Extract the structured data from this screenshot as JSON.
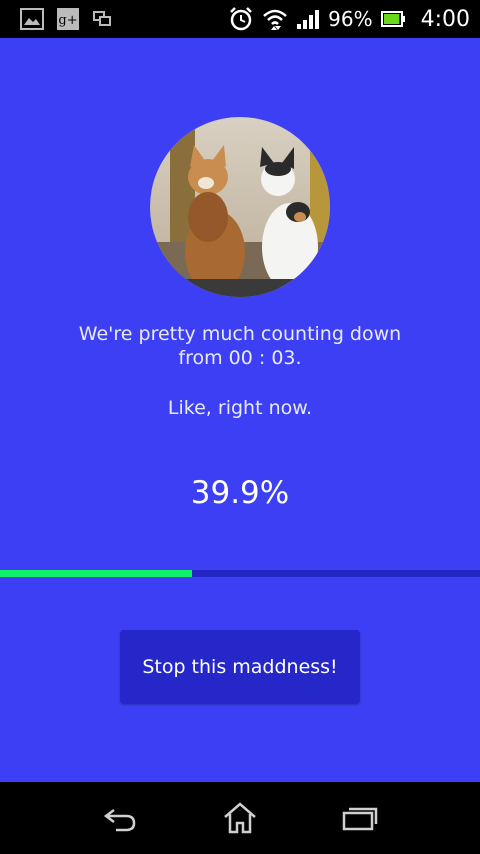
{
  "status_bar": {
    "left_icons": [
      "gallery-icon",
      "google-plus-icon",
      "screens-icon"
    ],
    "right_icons": [
      "alarm-icon",
      "wifi-icon",
      "signal-icon",
      "battery-icon"
    ],
    "battery_percent": "96%",
    "battery_level": 0.96,
    "time": "4:00"
  },
  "main": {
    "avatar_icon": "cats-photo",
    "message_line1": "We're pretty much counting down",
    "message_line2": "from 00 : 03.",
    "message_sub": "Like, right now.",
    "percent_text": "39.9%",
    "progress": 0.399,
    "stop_button_label": "Stop this maddness!"
  },
  "nav_bar": {
    "icons": [
      "back-icon",
      "home-icon",
      "recents-icon"
    ]
  },
  "colors": {
    "background": "#3d3ff5",
    "progress_fill": "#11f06b",
    "progress_track": "#2326c4",
    "button": "#2527c8"
  }
}
